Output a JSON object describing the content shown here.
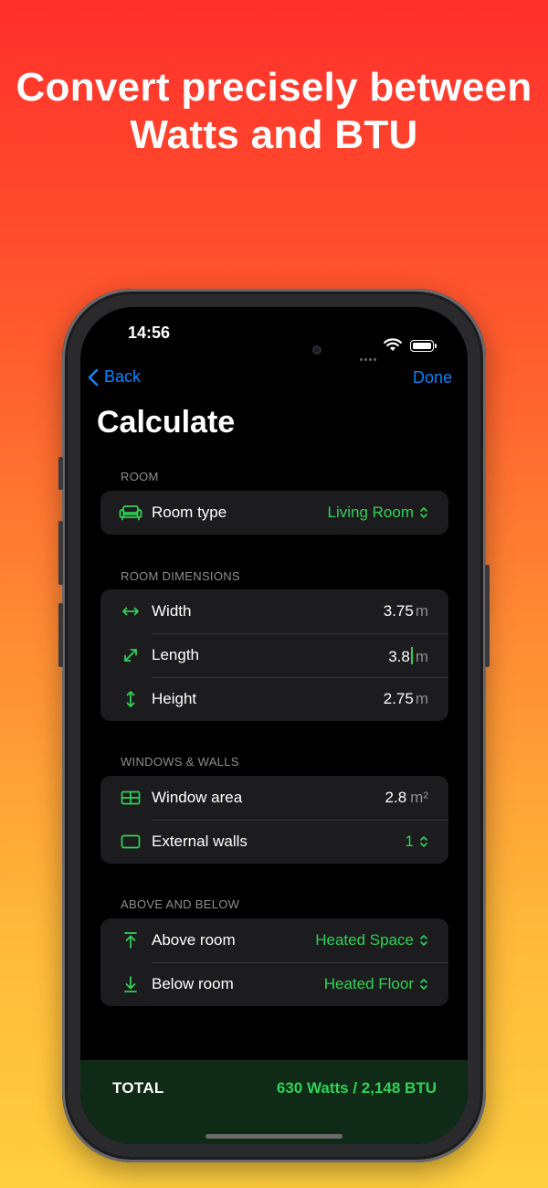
{
  "headline": "Convert precisely between Watts and BTU",
  "status": {
    "time": "14:56"
  },
  "nav": {
    "back": "Back",
    "done": "Done"
  },
  "page_title": "Calculate",
  "sections": {
    "room": {
      "label": "ROOM",
      "room_type": {
        "label": "Room type",
        "value": "Living Room"
      }
    },
    "dimensions": {
      "label": "ROOM DIMENSIONS",
      "width": {
        "label": "Width",
        "value": "3.75",
        "unit": "m"
      },
      "length": {
        "label": "Length",
        "value": "3.8",
        "unit": "m"
      },
      "height": {
        "label": "Height",
        "value": "2.75",
        "unit": "m"
      }
    },
    "windows": {
      "label": "WINDOWS & WALLS",
      "window_area": {
        "label": "Window area",
        "value": "2.8",
        "unit": "m²"
      },
      "external_walls": {
        "label": "External walls",
        "value": "1"
      }
    },
    "above_below": {
      "label": "ABOVE AND BELOW",
      "above": {
        "label": "Above room",
        "value": "Heated Space"
      },
      "below": {
        "label": "Below room",
        "value": "Heated Floor"
      }
    }
  },
  "total": {
    "label": "TOTAL",
    "value": "630 Watts / 2,148 BTU"
  },
  "colors": {
    "accent": "#30d158",
    "link": "#0a84ff",
    "footer": "#0f2a16"
  },
  "icons": {
    "room_type": "sofa-icon",
    "width": "arrow-left-right-icon",
    "length": "arrow-diagonal-icon",
    "height": "arrow-up-down-icon",
    "window_area": "window-grid-icon",
    "external_walls": "wall-rectangle-icon",
    "above": "arrow-up-to-line-icon",
    "below": "arrow-down-to-line-icon"
  }
}
